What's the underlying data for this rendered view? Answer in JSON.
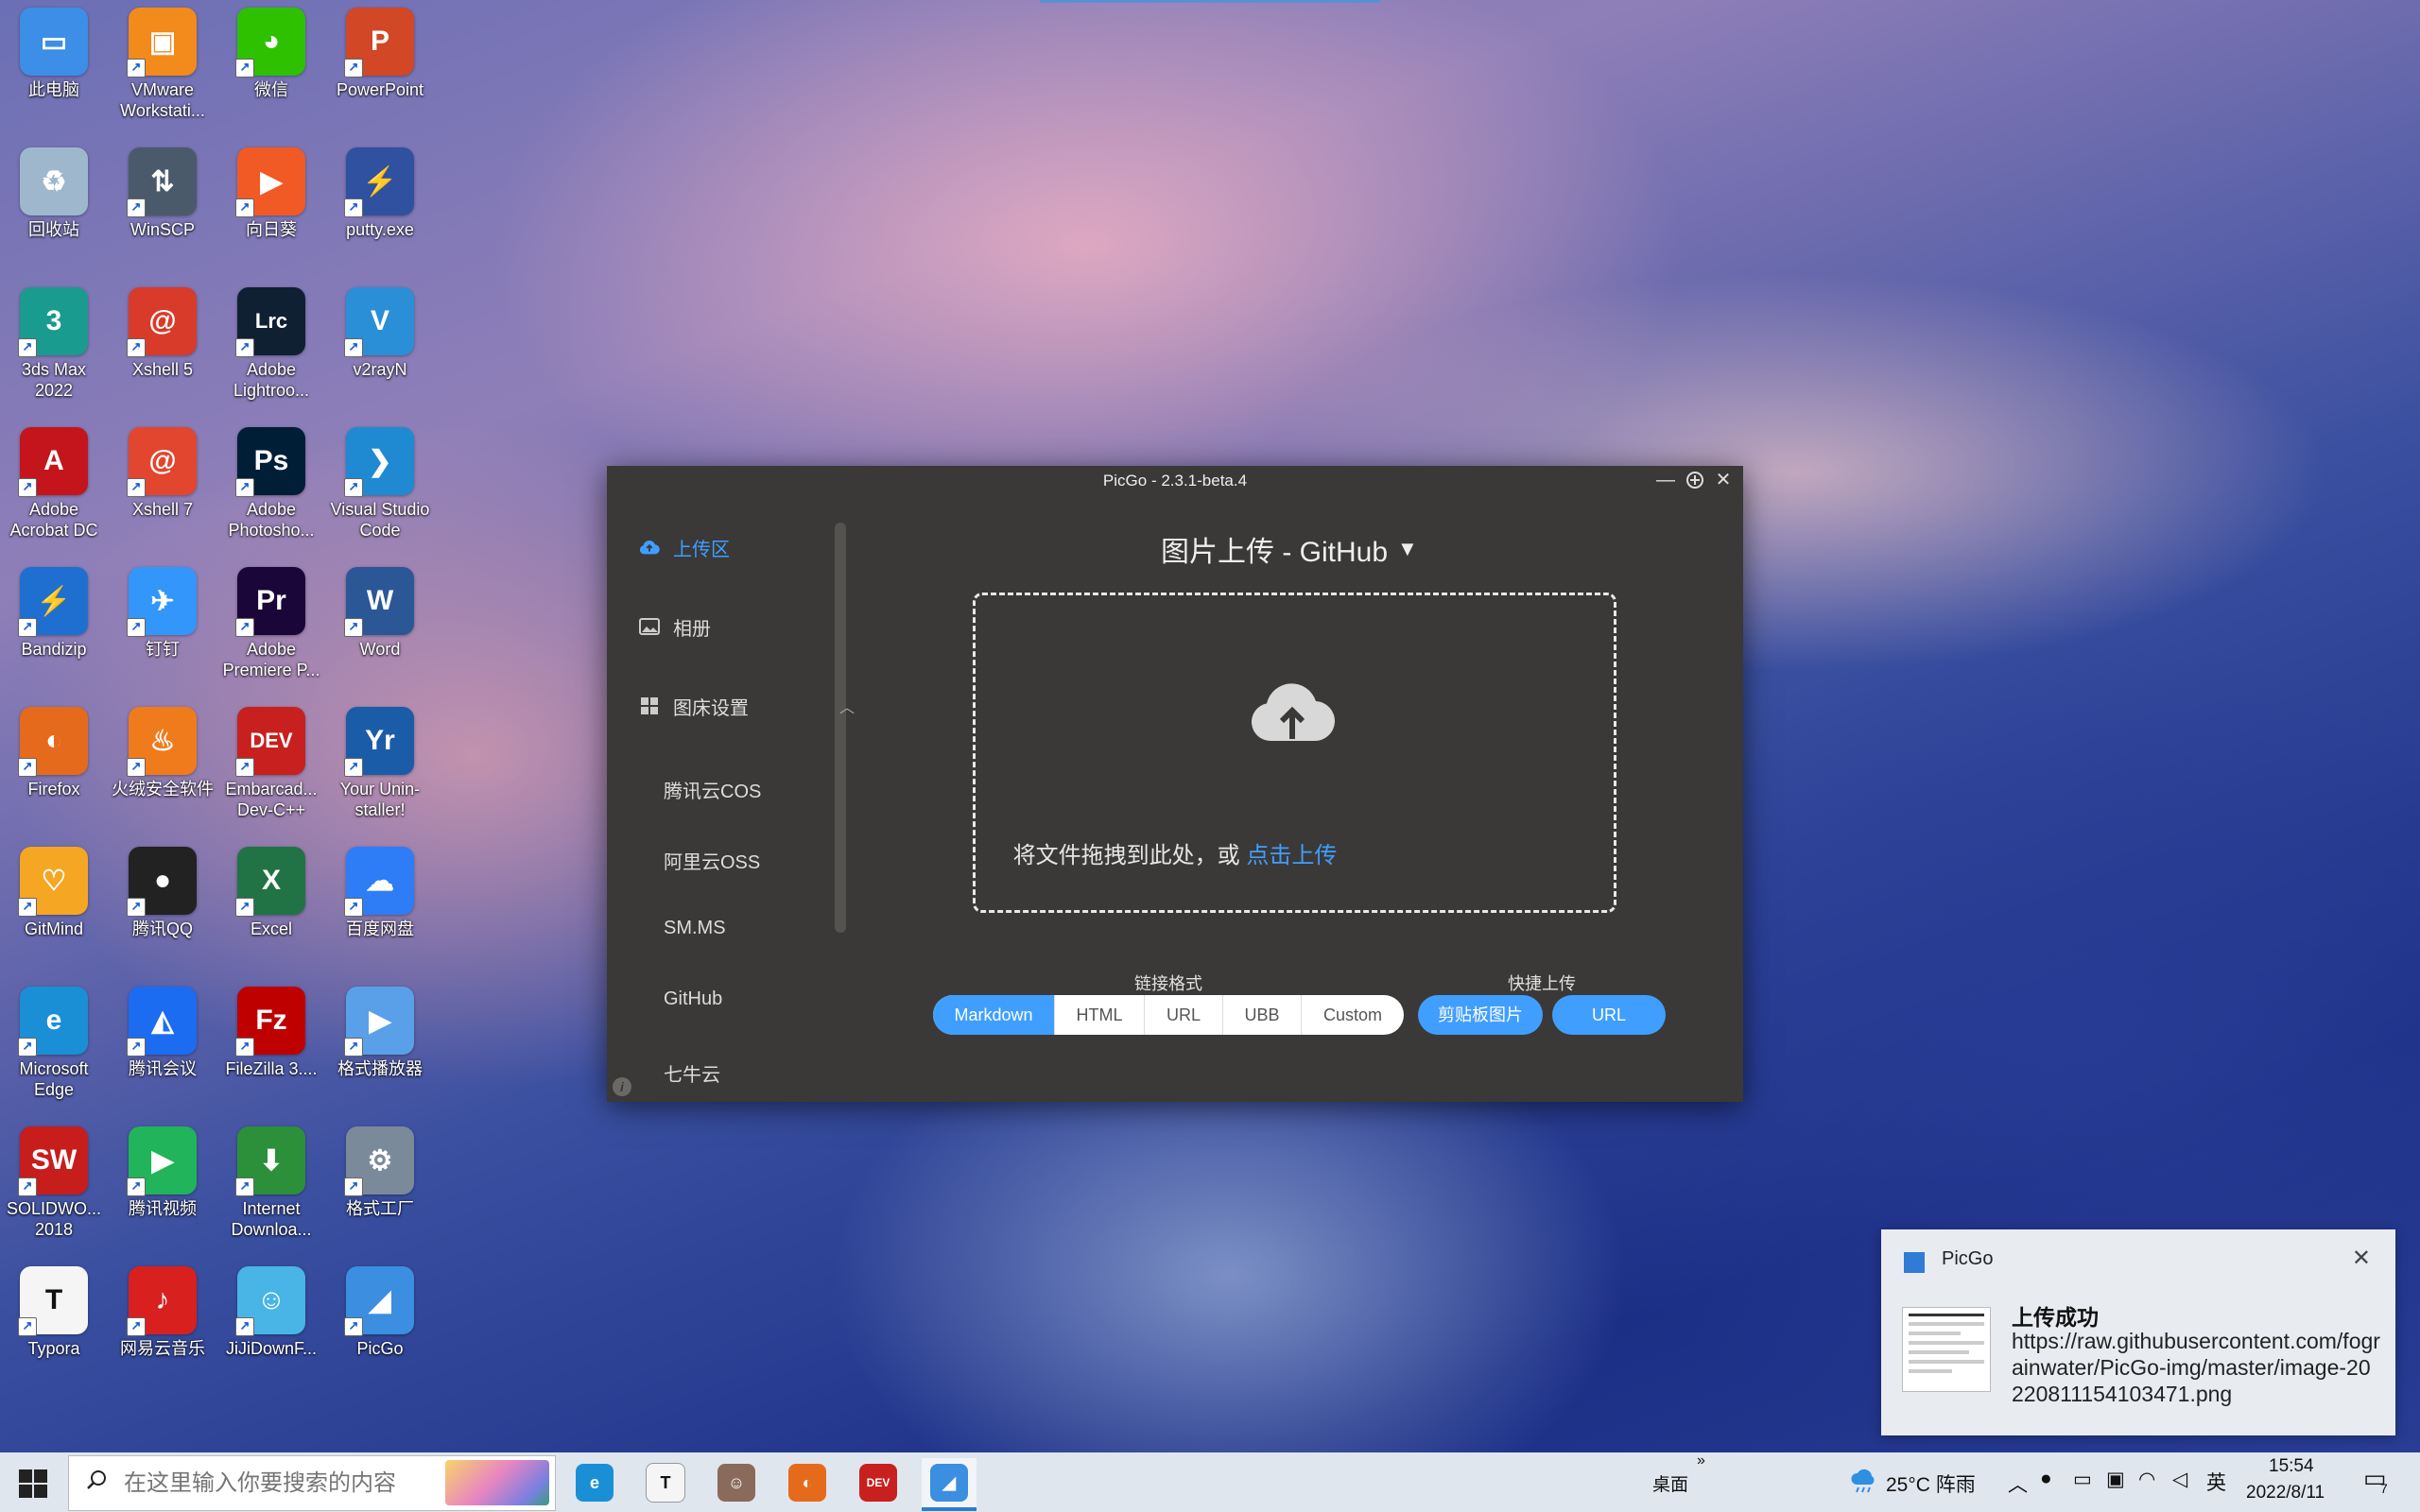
{
  "desktop": {
    "icons": [
      {
        "label": "此电脑",
        "icon": "computer-icon",
        "color": "#3d8ee6",
        "glyph": "▭"
      },
      {
        "label": "VMware Workstati...",
        "icon": "vmware-icon",
        "color": "#f28a1c",
        "glyph": "▣"
      },
      {
        "label": "微信",
        "icon": "wechat-icon",
        "color": "#2dc100",
        "glyph": "◕"
      },
      {
        "label": "PowerPoint",
        "icon": "powerpoint-icon",
        "color": "#d24726",
        "glyph": "P"
      },
      {
        "label": "回收站",
        "icon": "recycle-bin-icon",
        "color": "#9fb7cc",
        "glyph": "♻"
      },
      {
        "label": "WinSCP",
        "icon": "winscp-icon",
        "color": "#4a5a6a",
        "glyph": "⇅"
      },
      {
        "label": "向日葵",
        "icon": "sunflower-icon",
        "color": "#f15a24",
        "glyph": "▶"
      },
      {
        "label": "putty.exe",
        "icon": "putty-icon",
        "color": "#3050a0",
        "glyph": "⚡"
      },
      {
        "label": "3ds Max 2022",
        "icon": "3dsmax-icon",
        "color": "#1a9b8f",
        "glyph": "3"
      },
      {
        "label": "Xshell 5",
        "icon": "xshell5-icon",
        "color": "#d93b2b",
        "glyph": "@"
      },
      {
        "label": "Adobe Lightroo...",
        "icon": "lightroom-icon",
        "color": "#0f2033",
        "glyph": "Lrc"
      },
      {
        "label": "v2rayN",
        "icon": "v2rayn-icon",
        "color": "#2a8fd6",
        "glyph": "V"
      },
      {
        "label": "Adobe Acrobat DC",
        "icon": "acrobat-icon",
        "color": "#c4151c",
        "glyph": "A"
      },
      {
        "label": "Xshell 7",
        "icon": "xshell7-icon",
        "color": "#e2462f",
        "glyph": "@"
      },
      {
        "label": "Adobe Photosho...",
        "icon": "photoshop-icon",
        "color": "#001e36",
        "glyph": "Ps"
      },
      {
        "label": "Visual Studio Code",
        "icon": "vscode-icon",
        "color": "#1f8ad2",
        "glyph": "❯"
      },
      {
        "label": "Bandizip",
        "icon": "bandizip-icon",
        "color": "#1f6fd0",
        "glyph": "⚡"
      },
      {
        "label": "钉钉",
        "icon": "dingtalk-icon",
        "color": "#3296fa",
        "glyph": "✈"
      },
      {
        "label": "Adobe Premiere P...",
        "icon": "premiere-icon",
        "color": "#1a0638",
        "glyph": "Pr"
      },
      {
        "label": "Word",
        "icon": "word-icon",
        "color": "#2b5797",
        "glyph": "W"
      },
      {
        "label": "Firefox",
        "icon": "firefox-icon",
        "color": "#e66a1c",
        "glyph": "◐"
      },
      {
        "label": "火绒安全软件",
        "icon": "huorong-icon",
        "color": "#f07b1d",
        "glyph": "♨"
      },
      {
        "label": "Embarcad... Dev-C++",
        "icon": "devcpp-icon",
        "color": "#c8201f",
        "glyph": "DEV"
      },
      {
        "label": "Your Unin-staller!",
        "icon": "uninstaller-icon",
        "color": "#1b5ca8",
        "glyph": "Yr"
      },
      {
        "label": "GitMind",
        "icon": "gitmind-icon",
        "color": "#f5a623",
        "glyph": "♡"
      },
      {
        "label": "腾讯QQ",
        "icon": "qq-icon",
        "color": "#222222",
        "glyph": "●"
      },
      {
        "label": "Excel",
        "icon": "excel-icon",
        "color": "#217346",
        "glyph": "X"
      },
      {
        "label": "百度网盘",
        "icon": "baidu-netdisk-icon",
        "color": "#2e7df6",
        "glyph": "☁"
      },
      {
        "label": "Microsoft Edge",
        "icon": "edge-icon",
        "color": "#1a8fd6",
        "glyph": "e"
      },
      {
        "label": "腾讯会议",
        "icon": "tencent-meeting-icon",
        "color": "#1c6cf2",
        "glyph": "◭"
      },
      {
        "label": "FileZilla 3....",
        "icon": "filezilla-icon",
        "color": "#bf0000",
        "glyph": "Fz"
      },
      {
        "label": "格式播放器",
        "icon": "format-player-icon",
        "color": "#5aa0e8",
        "glyph": "▶"
      },
      {
        "label": "SOLIDWO... 2018",
        "icon": "solidworks-icon",
        "color": "#c81d1d",
        "glyph": "SW"
      },
      {
        "label": "腾讯视频",
        "icon": "tencent-video-icon",
        "color": "#21b45a",
        "glyph": "▶"
      },
      {
        "label": "Internet Downloa...",
        "icon": "idm-icon",
        "color": "#2c8f3a",
        "glyph": "⬇"
      },
      {
        "label": "格式工厂",
        "icon": "format-factory-icon",
        "color": "#7a8a9a",
        "glyph": "⚙"
      },
      {
        "label": "Typora",
        "icon": "typora-icon",
        "color": "#f5f5f5",
        "glyph": "T"
      },
      {
        "label": "网易云音乐",
        "icon": "netease-music-icon",
        "color": "#d8201f",
        "glyph": "♪"
      },
      {
        "label": "JiJiDownF...",
        "icon": "jijidown-icon",
        "color": "#49b4e6",
        "glyph": "☺"
      },
      {
        "label": "PicGo",
        "icon": "picgo-icon",
        "color": "#3b8ee0",
        "glyph": "◢"
      }
    ]
  },
  "picgo": {
    "title": "PicGo - 2.3.1-beta.4",
    "sidebar": {
      "upload": "上传区",
      "album": "相册",
      "settings": "图床设置",
      "subitems": [
        "腾讯云COS",
        "阿里云OSS",
        "SM.MS",
        "GitHub",
        "七牛云"
      ]
    },
    "main": {
      "title": "图片上传 - GitHub",
      "drop_text": "将文件拖拽到此处，或 ",
      "drop_link": "点击上传",
      "link_format_label": "链接格式",
      "link_formats": [
        "Markdown",
        "HTML",
        "URL",
        "UBB",
        "Custom"
      ],
      "active_format": "Markdown",
      "quick_upload_label": "快捷上传",
      "quick_clipboard": "剪贴板图片",
      "quick_url": "URL"
    },
    "accent_color": "#409eff"
  },
  "notification": {
    "app": "PicGo",
    "title": "上传成功",
    "body": "https://raw.githubusercontent.com/fograinwater/PicGo-img/master/image-20220811154103471.png"
  },
  "taskbar": {
    "search_placeholder": "在这里输入你要搜索的内容",
    "desktop_label": "桌面",
    "weather": "25°C 阵雨",
    "ime": "英",
    "time": "15:54",
    "date": "2022/8/11",
    "notification_count": "7",
    "apps": [
      {
        "icon": "edge-icon",
        "color": "#1a8fd6",
        "glyph": "e"
      },
      {
        "icon": "typora-icon",
        "color": "#f5f5f5",
        "glyph": "T"
      },
      {
        "icon": "avatar-app-icon",
        "color": "#8a6a5a",
        "glyph": "☺"
      },
      {
        "icon": "firefox-icon",
        "color": "#e66a1c",
        "glyph": "◐"
      },
      {
        "icon": "devcpp-icon",
        "color": "#c8201f",
        "glyph": "DEV"
      },
      {
        "icon": "picgo-icon",
        "color": "#3b8ee0",
        "glyph": "◢"
      }
    ]
  }
}
